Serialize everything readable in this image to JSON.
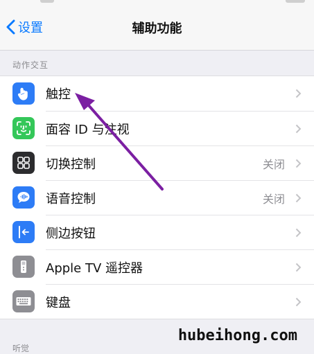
{
  "nav": {
    "back_label": "设置",
    "title": "辅助功能"
  },
  "section_header": "动作交互",
  "rows": [
    {
      "label": "触控",
      "value": "",
      "icon": "touch-hand-icon",
      "icon_bg": "#2d7cf6"
    },
    {
      "label": "面容 ID 与注视",
      "value": "",
      "icon": "face-id-icon",
      "icon_bg": "#34c759"
    },
    {
      "label": "切换控制",
      "value": "关闭",
      "icon": "switch-control-icon",
      "icon_bg": "#2c2c2e"
    },
    {
      "label": "语音控制",
      "value": "关闭",
      "icon": "voice-control-icon",
      "icon_bg": "#2d7cf6"
    },
    {
      "label": "侧边按钮",
      "value": "",
      "icon": "side-button-icon",
      "icon_bg": "#2d7cf6"
    },
    {
      "label": "Apple TV 遥控器",
      "value": "",
      "icon": "tv-remote-icon",
      "icon_bg": "#8e8e93"
    },
    {
      "label": "键盘",
      "value": "",
      "icon": "keyboard-icon",
      "icon_bg": "#8e8e93"
    }
  ],
  "footer_header": "听觉",
  "watermark": "hubeihong.com",
  "colors": {
    "accent": "#0a7aff",
    "arrow": "#7b1fa2"
  }
}
